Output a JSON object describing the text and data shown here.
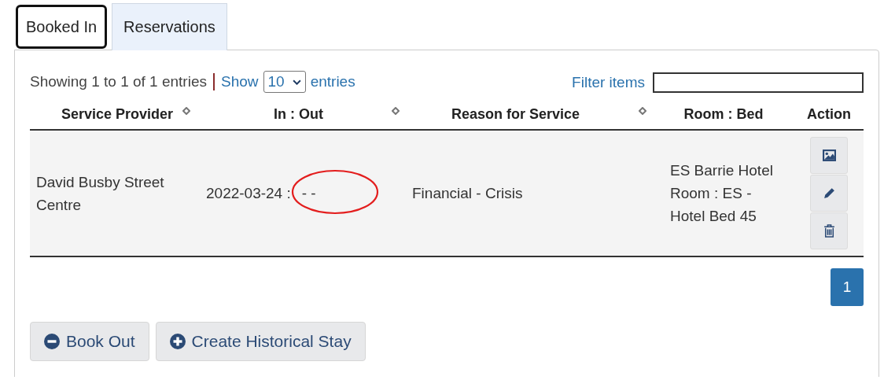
{
  "tabs": [
    {
      "label": "Booked In",
      "selected": true
    },
    {
      "label": "Reservations",
      "selected": false
    }
  ],
  "info": {
    "summary": "Showing 1 to 1 of 1 entries",
    "show_label": "Show",
    "page_size": "10",
    "entries_label": "entries"
  },
  "filter": {
    "label": "Filter items"
  },
  "table": {
    "columns": [
      {
        "label": "Service Provider",
        "sortable": true
      },
      {
        "label": "In : Out",
        "sortable": true
      },
      {
        "label": "Reason for Service",
        "sortable": true
      },
      {
        "label": "Room : Bed",
        "sortable": false
      },
      {
        "label": "Action",
        "sortable": false
      }
    ],
    "rows": [
      {
        "provider": "David Busby Street Centre",
        "in_out": "2022-03-24 :",
        "out": "- -",
        "circled": true,
        "reason": "Financial - Crisis",
        "room_bed": "ES Barrie Hotel Room : ES - Hotel Bed 45"
      }
    ]
  },
  "pagination": [
    {
      "label": "1",
      "selected": true
    }
  ],
  "buttons": [
    {
      "label": "Book Out",
      "kind": "minus"
    },
    {
      "label": "Create Historical Stay",
      "kind": "plus"
    }
  ]
}
